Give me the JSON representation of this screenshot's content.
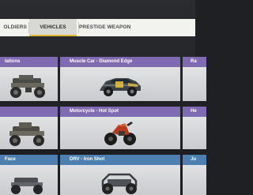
{
  "tabs": [
    {
      "label": "OLDIERS",
      "selected": false
    },
    {
      "label": "VEHICLES",
      "selected": true
    },
    {
      "label": "PRESTIGE WEAPON",
      "selected": false
    }
  ],
  "colors": {
    "accent_underline": "#e0b836",
    "rarity_purple": "#7f6bb1",
    "rarity_blue": "#4d7fb0"
  },
  "cards": [
    {
      "title": "lations",
      "rarity": "purple",
      "vehicle_icon": "armored-atv-icon"
    },
    {
      "title": "Muscle Car - Diamond Edge",
      "rarity": "purple",
      "vehicle_icon": "muscle-car-icon"
    },
    {
      "title": "Ra",
      "rarity": "purple",
      "vehicle_icon": ""
    },
    {
      "title": "",
      "rarity": "purple",
      "vehicle_icon": "armored-atv-icon"
    },
    {
      "title": "Motorcycle - Hot Spot",
      "rarity": "purple",
      "vehicle_icon": "motorcycle-icon"
    },
    {
      "title": "He",
      "rarity": "purple",
      "vehicle_icon": ""
    },
    {
      "title": "Face",
      "rarity": "blue",
      "vehicle_icon": "atv-icon"
    },
    {
      "title": "DRV - Iron Shot",
      "rarity": "blue",
      "vehicle_icon": "drv-buggy-icon"
    },
    {
      "title": "Ju",
      "rarity": "blue",
      "vehicle_icon": ""
    }
  ]
}
